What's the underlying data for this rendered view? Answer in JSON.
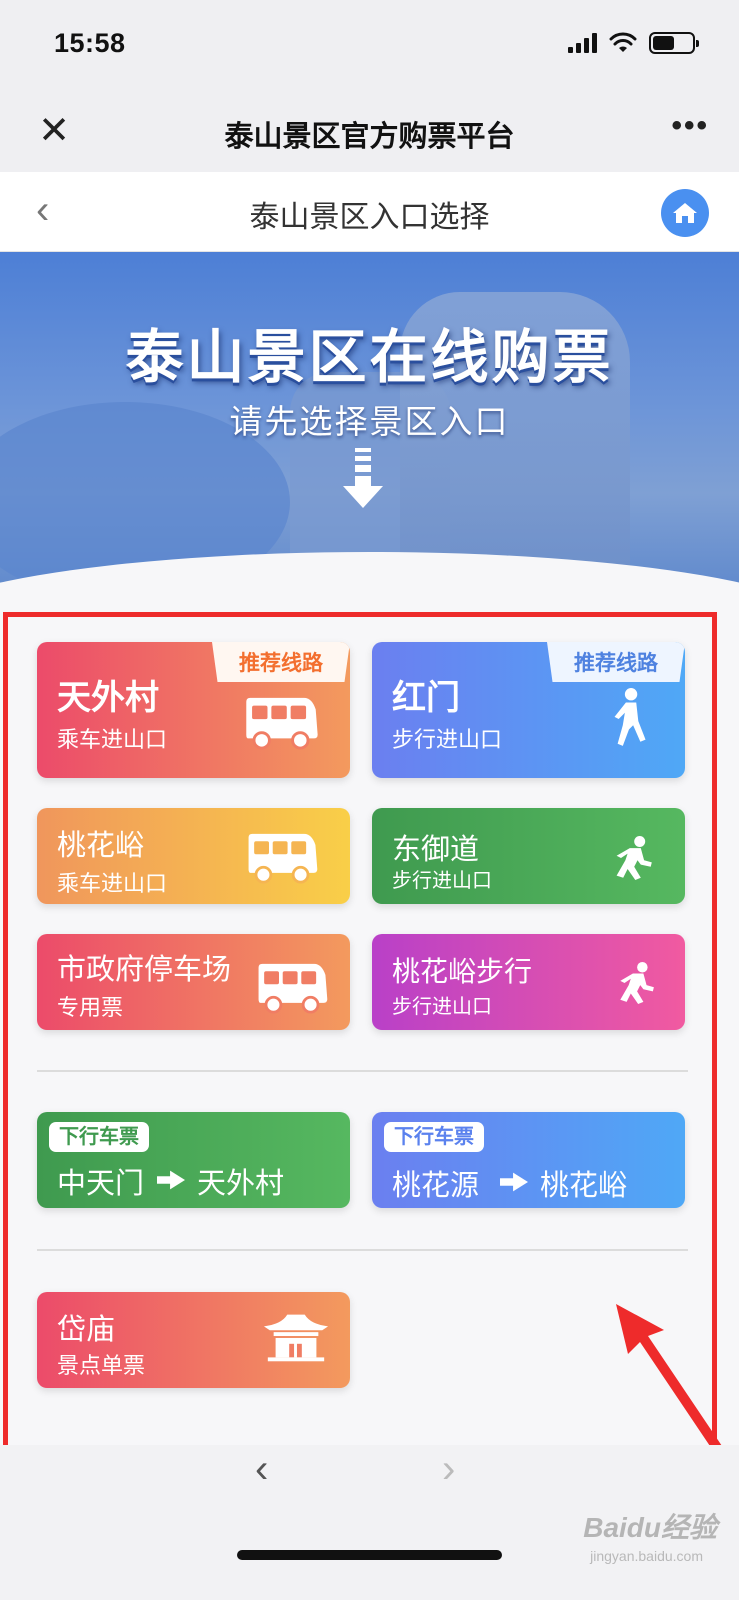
{
  "status_bar": {
    "time": "15:58"
  },
  "nav": {
    "title": "泰山景区官方购票平台",
    "close": "✕",
    "more": "•••"
  },
  "header": {
    "title": "泰山景区入口选择",
    "back": "‹"
  },
  "banner": {
    "title": "泰山景区在线购票",
    "subtitle": "请先选择景区入口"
  },
  "cards": {
    "tianwaicun": {
      "name": "天外村",
      "sub": "乘车进山口",
      "ribbon": "推荐线路"
    },
    "hongmen": {
      "name": "红门",
      "sub": "步行进山口",
      "ribbon": "推荐线路"
    },
    "taohuayu": {
      "name": "桃花峪",
      "sub": "乘车进山口"
    },
    "dongyudao": {
      "name": "东御道",
      "sub": "步行进山口"
    },
    "shizhengfu": {
      "name": "市政府停车场",
      "sub": "专用票"
    },
    "taohuayu_walk": {
      "name": "桃花峪步行",
      "sub": "步行进山口"
    },
    "down1": {
      "tag": "下行车票",
      "from": "中天门",
      "to": "天外村"
    },
    "down2": {
      "tag": "下行车票",
      "from": "桃花源",
      "to": "桃花峪"
    },
    "daimiao": {
      "name": "岱庙",
      "sub": "景点单票"
    }
  },
  "bottom": {
    "back": "‹",
    "forward": "›"
  },
  "watermark": {
    "brand": "Baidu经验",
    "url": "jingyan.baidu.com"
  },
  "colors": {
    "red_orange": [
      "#ec4b6a",
      "#f39a5e"
    ],
    "blue": [
      "#6b7ff0",
      "#4fa8f6"
    ],
    "orange_yellow": [
      "#f0965c",
      "#f9cf48"
    ],
    "green": [
      "#3f9a4f",
      "#56b860"
    ],
    "magenta": [
      "#b940c8",
      "#f15aa0"
    ],
    "highlight": "#ee2b2b"
  }
}
